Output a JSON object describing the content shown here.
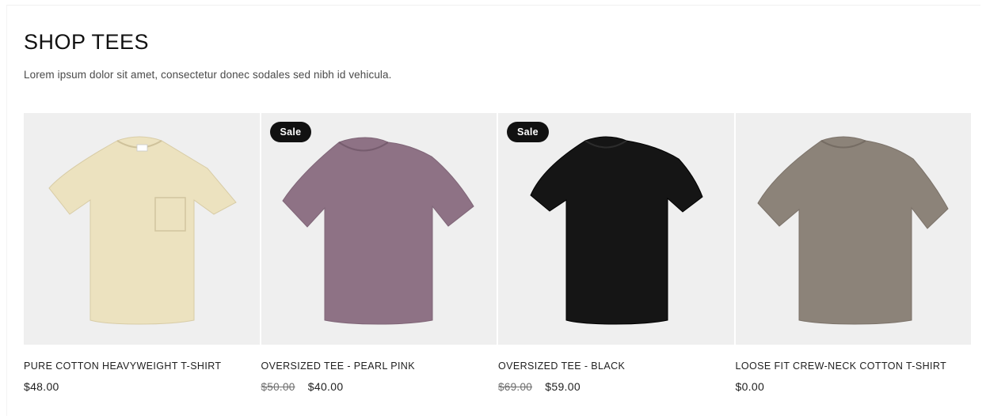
{
  "section": {
    "title": "SHOP TEES",
    "description": "Lorem ipsum dolor sit amet, consectetur donec sodales sed nibh id vehicula."
  },
  "products": [
    {
      "name": "PURE COTTON HEAVYWEIGHT T-SHIRT",
      "price": "$48.00",
      "compare_price": "",
      "badge": "",
      "image_icon": "tshirt-pocket-cream-icon",
      "color": "#ece2bf"
    },
    {
      "name": "OVERSIZED TEE - PEARL PINK",
      "price": "$40.00",
      "compare_price": "$50.00",
      "badge": "Sale",
      "image_icon": "tshirt-pearl-pink-icon",
      "color": "#8e7285"
    },
    {
      "name": "OVERSIZED TEE - BLACK",
      "price": "$59.00",
      "compare_price": "$69.00",
      "badge": "Sale",
      "image_icon": "tshirt-black-icon",
      "color": "#151515"
    },
    {
      "name": "LOOSE FIT CREW-NECK COTTON T-SHIRT",
      "price": "$0.00",
      "compare_price": "",
      "badge": "",
      "image_icon": "tshirt-taupe-icon",
      "color": "#8c8379"
    }
  ]
}
